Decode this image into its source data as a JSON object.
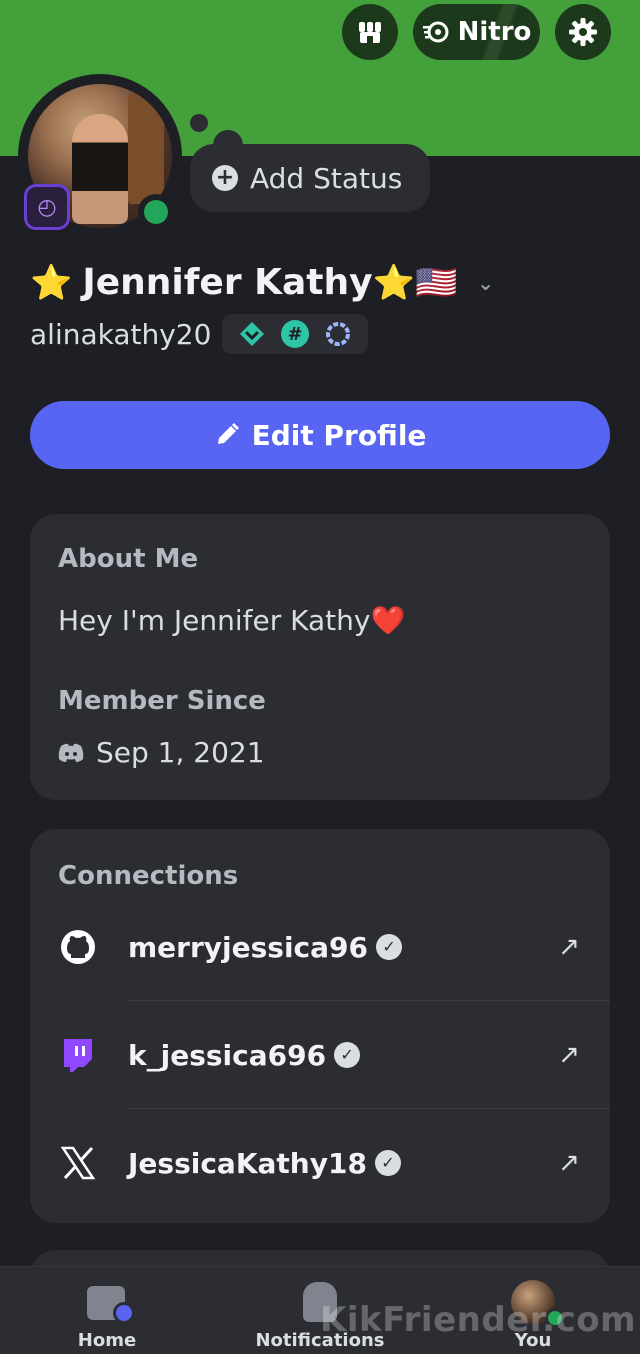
{
  "header": {
    "nitro_label": "Nitro",
    "shop_icon": "shop-icon",
    "settings_icon": "gear-icon",
    "banner_color": "#43a03a"
  },
  "profile": {
    "add_status_label": "Add Status",
    "display_name": "Jennifer Kathy",
    "name_prefix_emoji": "⭐",
    "name_suffix_emoji": "⭐🇺🇸",
    "username": "alinakathy20",
    "edit_profile_label": "Edit Profile",
    "online_status_color": "#23a55a",
    "accent_color": "#5865f2"
  },
  "about": {
    "label": "About Me",
    "text": "Hey I'm Jennifer Kathy",
    "text_emoji": "❤️",
    "member_since_label": "Member Since",
    "member_since_date": "Sep 1, 2021"
  },
  "connections": {
    "label": "Connections",
    "items": [
      {
        "service_icon": "github-icon",
        "name": "merryjessica96"
      },
      {
        "service_icon": "twitch-icon",
        "name": "k_jessica696"
      },
      {
        "service_icon": "x-icon",
        "name": "JessicaKathy18"
      }
    ]
  },
  "tabbar": {
    "home_label": "Home",
    "notifications_label": "Notifications",
    "you_label": "You"
  },
  "watermark": "KikFriender.com"
}
